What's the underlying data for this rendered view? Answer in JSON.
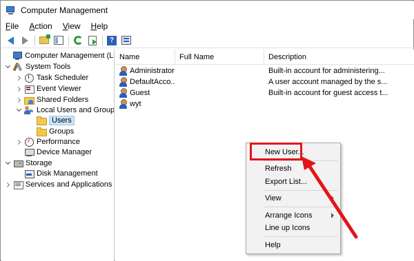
{
  "window": {
    "title": "Computer Management"
  },
  "menu": [
    {
      "label_pre": "",
      "label_u": "F",
      "label_post": "ile"
    },
    {
      "label_pre": "",
      "label_u": "A",
      "label_post": "ction"
    },
    {
      "label_pre": "",
      "label_u": "V",
      "label_post": "iew"
    },
    {
      "label_pre": "",
      "label_u": "H",
      "label_post": "elp"
    }
  ],
  "toolbar": {
    "buttons": [
      "back-icon",
      "forward-icon",
      "up-folder-icon",
      "show-hide-tree-icon",
      "refresh-icon",
      "export-list-icon",
      "help-icon",
      "properties-icon"
    ],
    "help_glyph": "?"
  },
  "tree": [
    {
      "label": "Computer Management (Local",
      "icon": "computer-icon"
    },
    {
      "label": "System Tools",
      "icon": "tools-icon"
    },
    {
      "label": "Task Scheduler",
      "icon": "clock-icon"
    },
    {
      "label": "Event Viewer",
      "icon": "event-viewer-icon"
    },
    {
      "label": "Shared Folders",
      "icon": "shared-folder-icon"
    },
    {
      "label": "Local Users and Groups",
      "icon": "users-icon"
    },
    {
      "label": "Users",
      "icon": "folder-icon"
    },
    {
      "label": "Groups",
      "icon": "folder-icon"
    },
    {
      "label": "Performance",
      "icon": "performance-icon"
    },
    {
      "label": "Device Manager",
      "icon": "device-manager-icon"
    },
    {
      "label": "Storage",
      "icon": "storage-icon"
    },
    {
      "label": "Disk Management",
      "icon": "disk-icon"
    },
    {
      "label": "Services and Applications",
      "icon": "services-icon"
    }
  ],
  "list": {
    "columns": [
      "Name",
      "Full Name",
      "Description"
    ],
    "rows": [
      {
        "name": "Administrator",
        "full_name": "",
        "description": "Built-in account for administering..."
      },
      {
        "name": "DefaultAcco...",
        "full_name": "",
        "description": "A user account managed by the s..."
      },
      {
        "name": "Guest",
        "full_name": "",
        "description": "Built-in account for guest access t..."
      },
      {
        "name": "wyt",
        "full_name": "",
        "description": ""
      }
    ]
  },
  "context_menu": {
    "items": [
      "New User...",
      "Refresh",
      "Export List...",
      "View",
      "Arrange Icons",
      "Line up Icons",
      "Help"
    ]
  },
  "colors": {
    "highlight": "#e3141b",
    "selection": "#cce4f7",
    "accent": "#2b5fb8"
  }
}
